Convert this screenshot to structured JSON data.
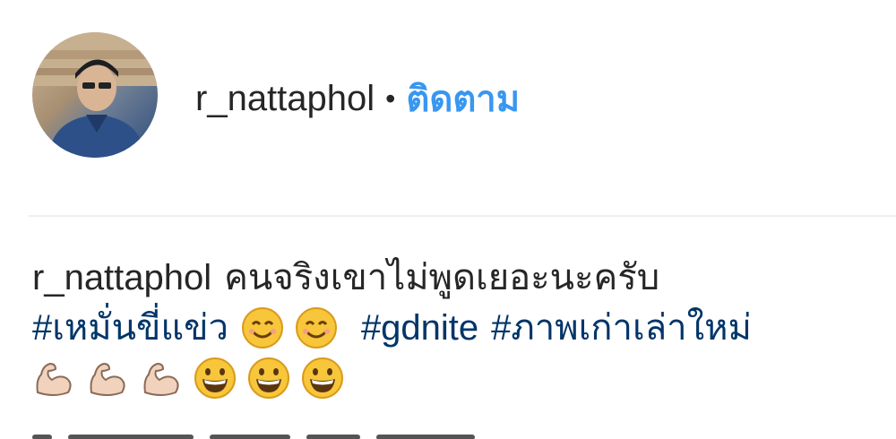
{
  "header": {
    "username": "r_nattaphol",
    "separator": "•",
    "follow_label": "ติดตาม",
    "avatar_icon": "profile-photo"
  },
  "caption": {
    "username": "r_nattaphol",
    "text": "คนจริงเขาไม่พูดเยอะนะครับ",
    "hashtag1": "#เหมั่นขี่แข่ว",
    "hashtag2": "#gdnite",
    "hashtag3": "#ภาพเก่าเล่าใหม่",
    "emojis_line2": [
      "smiling-face-icon",
      "smiling-face-icon"
    ],
    "emojis_line3": [
      "flexed-biceps-icon",
      "flexed-biceps-icon",
      "flexed-biceps-icon",
      "grinning-face-icon",
      "grinning-face-icon",
      "grinning-face-icon"
    ]
  },
  "colors": {
    "follow": "#3897f0",
    "hashtag": "#003569",
    "text": "#262626",
    "divider": "#efefef"
  }
}
